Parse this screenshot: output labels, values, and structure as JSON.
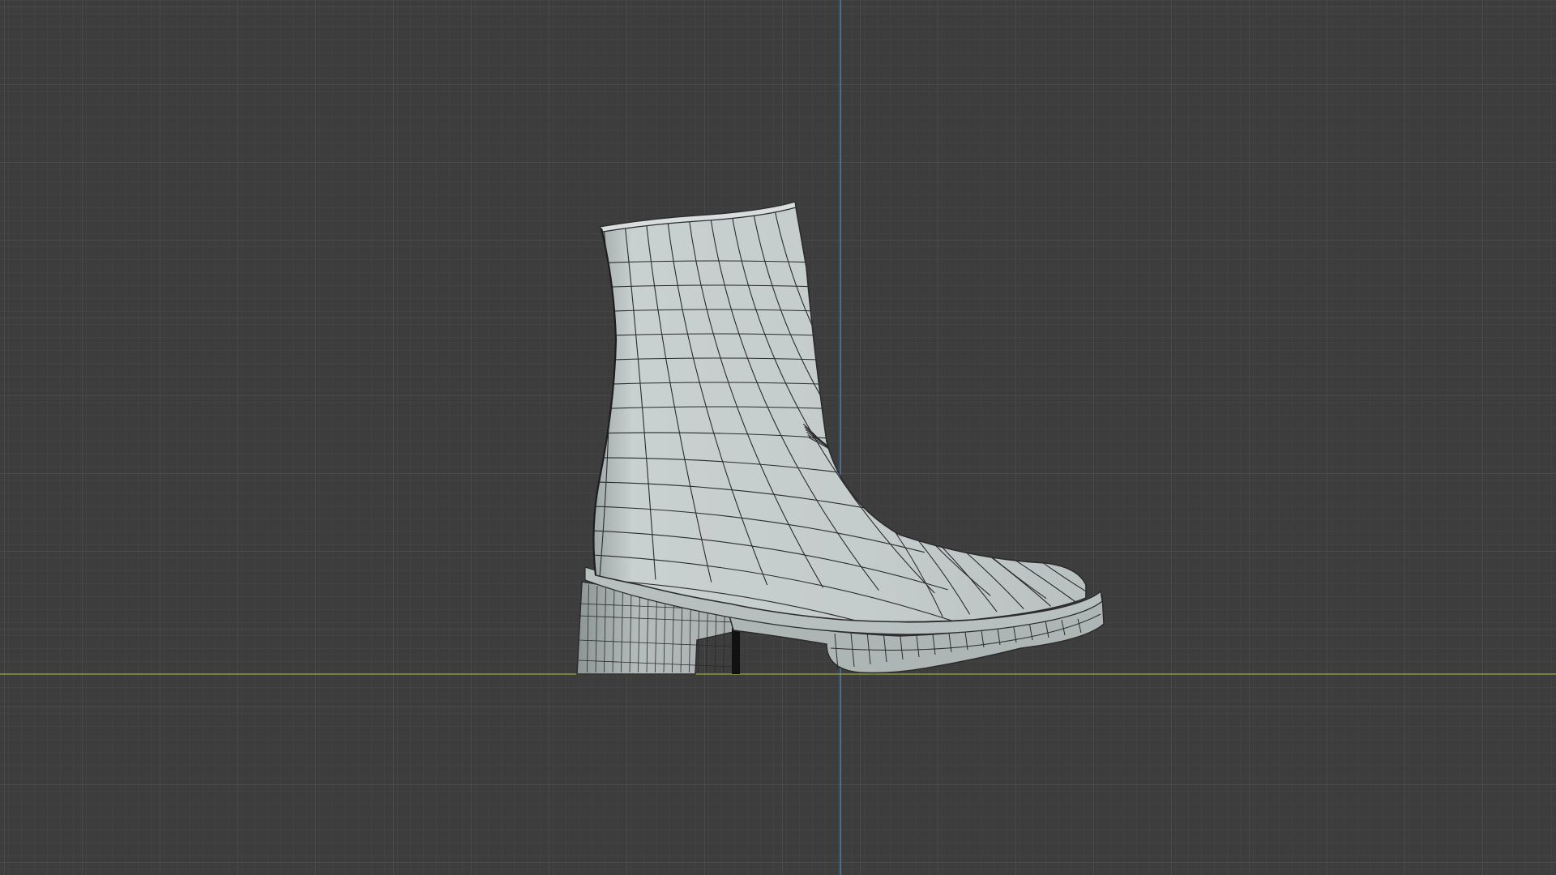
{
  "viewport": {
    "view": "orthographic-side",
    "shading": "solid-with-wireframe",
    "background_color": "#3d3d3d",
    "grid_minor_color": "#474747",
    "grid_major_color": "#525252",
    "axis_x_color": "#8a9a3c",
    "axis_z_color": "#4f7fb0",
    "model": {
      "name": "boot",
      "surface_color": "#c4cbcb",
      "wire_color": "#2b2b2b",
      "sole_color": "#aeb5b5"
    }
  }
}
